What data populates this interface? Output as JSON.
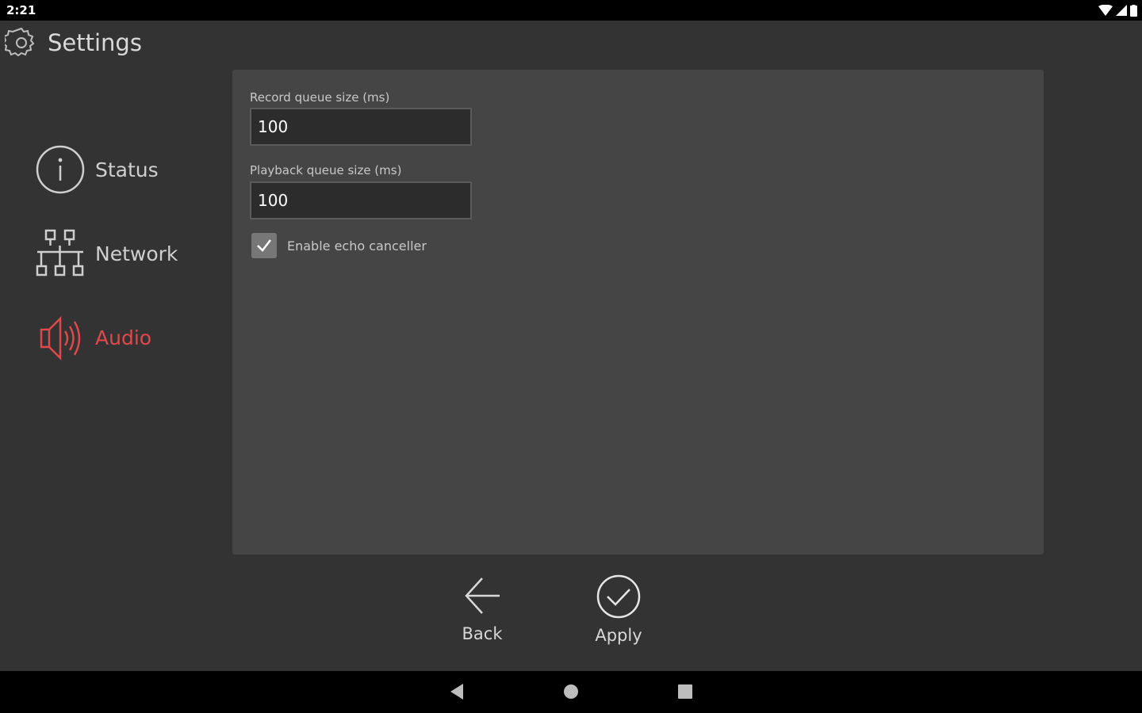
{
  "status_bar": {
    "time": "2:21",
    "icons": [
      "wifi-icon",
      "signal-icon",
      "battery-icon"
    ]
  },
  "header": {
    "title": "Settings",
    "icon": "gear-icon"
  },
  "sidebar": {
    "items": [
      {
        "label": "Status",
        "icon": "info-icon",
        "active": false
      },
      {
        "label": "Network",
        "icon": "network-icon",
        "active": false
      },
      {
        "label": "Audio",
        "icon": "speaker-icon",
        "active": true
      }
    ]
  },
  "panel": {
    "record_queue": {
      "label": "Record queue size (ms)",
      "value": "100"
    },
    "playback_queue": {
      "label": "Playback queue size (ms)",
      "value": "100"
    },
    "echo_canceller": {
      "label": "Enable echo canceller",
      "checked": true
    }
  },
  "actions": {
    "back_label": "Back",
    "apply_label": "Apply"
  },
  "colors": {
    "accent": "#e0484b",
    "background": "#333333",
    "panel": "#454545"
  }
}
